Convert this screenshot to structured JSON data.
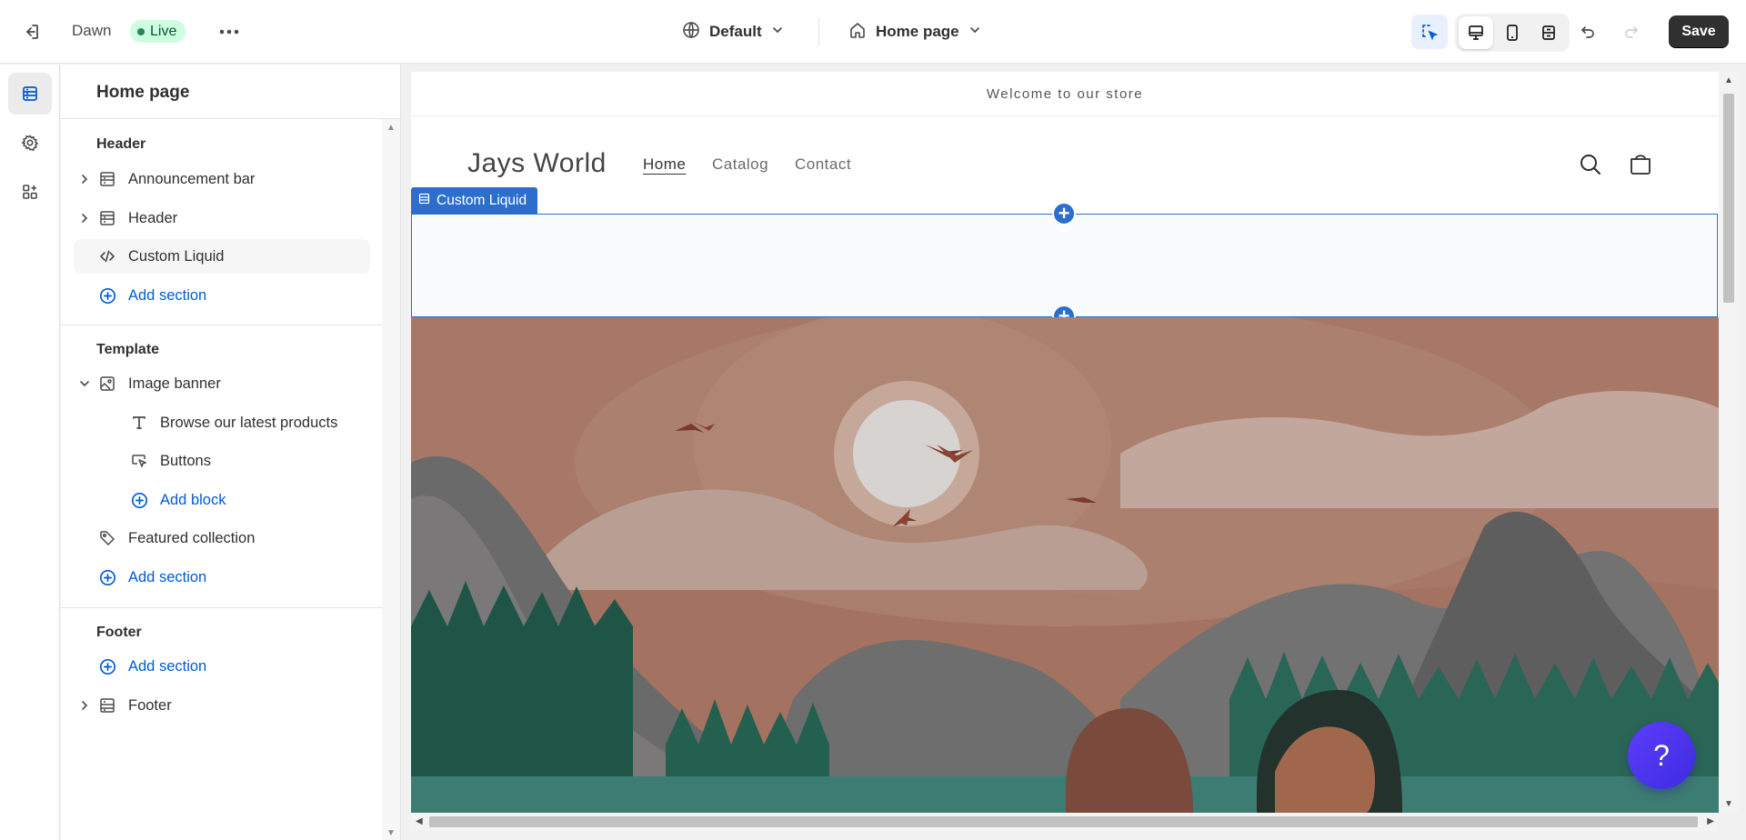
{
  "topbar": {
    "theme_name": "Dawn",
    "live_badge": "Live",
    "template_selector": "Default",
    "page_selector": "Home page",
    "save_label": "Save"
  },
  "sidebar": {
    "title": "Home page",
    "header_group": {
      "heading": "Header",
      "items": [
        {
          "label": "Announcement bar"
        },
        {
          "label": "Header"
        },
        {
          "label": "Custom Liquid"
        }
      ],
      "add_label": "Add section"
    },
    "template_group": {
      "heading": "Template",
      "image_banner": "Image banner",
      "blocks": [
        {
          "label": "Browse our latest products"
        },
        {
          "label": "Buttons"
        }
      ],
      "add_block_label": "Add block",
      "featured_collection": "Featured collection",
      "add_label": "Add section"
    },
    "footer_group": {
      "heading": "Footer",
      "add_label": "Add section",
      "footer_item": "Footer"
    }
  },
  "preview": {
    "announcement": "Welcome to our store",
    "store_name": "Jays World",
    "nav": [
      "Home",
      "Catalog",
      "Contact"
    ],
    "selected_section_tag": "Custom Liquid"
  },
  "help_button": "?",
  "colors": {
    "accent": "#2c6ecb",
    "link": "#005bd3",
    "live_bg": "#cdfee1",
    "save_bg": "#303030",
    "help_bg": "#4b33f0"
  }
}
